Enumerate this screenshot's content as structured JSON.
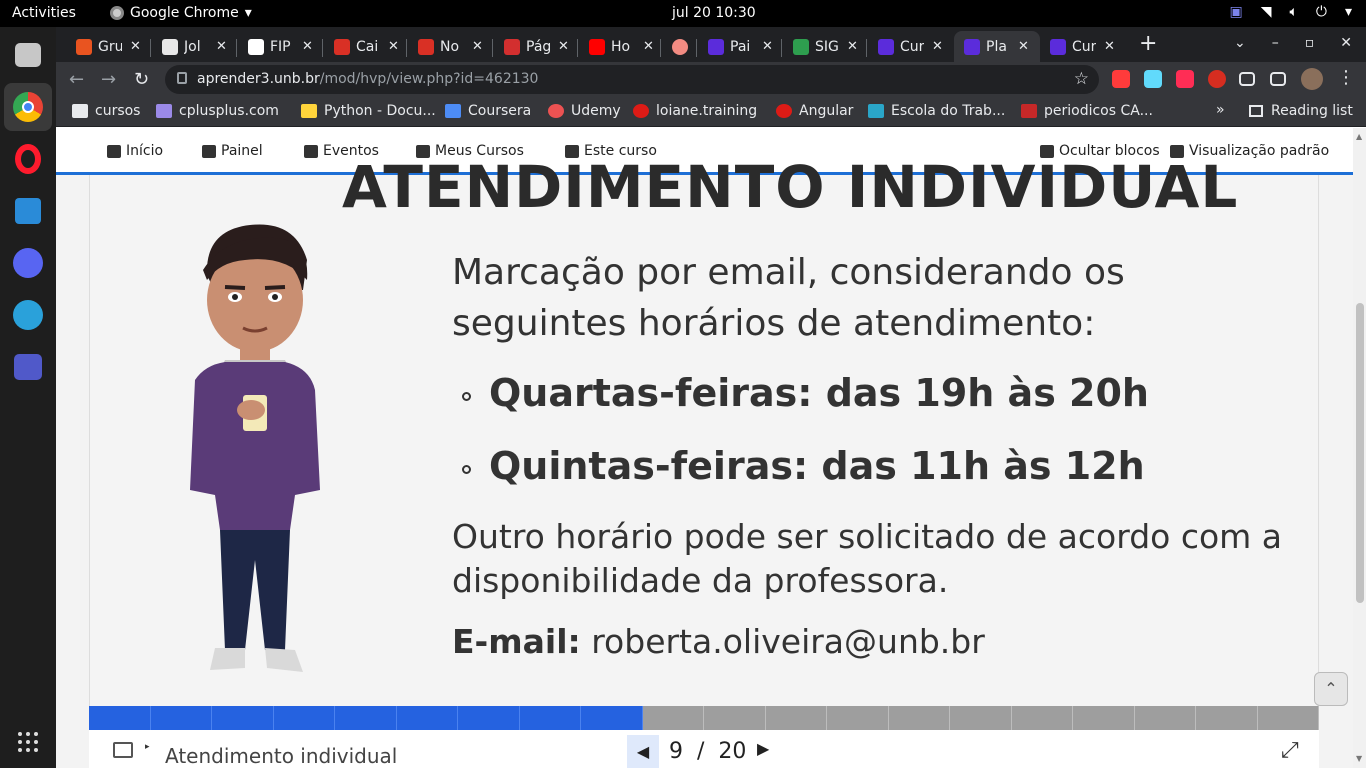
{
  "system_bar": {
    "activities": "Activities",
    "app_name": "Google Chrome",
    "app_menu_icon": "caret-down-icon",
    "clock": "jul 20  10:30",
    "tray_icons": [
      "teams-tray-icon",
      "wifi-icon",
      "volume-icon",
      "power-icon",
      "caret-down-icon"
    ]
  },
  "dock": {
    "items": [
      "files",
      "chrome",
      "opera",
      "vscode",
      "discord",
      "telegram",
      "teams"
    ],
    "colors": {
      "files": "#c7c7c7",
      "chrome": "#f4b400",
      "opera": "#ff1b2d",
      "vscode": "#2a8bd8",
      "discord": "#5865f2",
      "telegram": "#2aa1da",
      "teams": "#5059c9"
    }
  },
  "tabs": [
    {
      "label": "Gru",
      "favicon_color": "#e95420"
    },
    {
      "label": "Jol",
      "favicon_color": "#e8e8e8"
    },
    {
      "label": "FIP",
      "favicon_color": "#ffffff"
    },
    {
      "label": "Cai",
      "favicon_color": "#d93025"
    },
    {
      "label": "No",
      "favicon_color": "#d93025"
    },
    {
      "label": "Pág",
      "favicon_color": "#d32f2f"
    },
    {
      "label": "Ho",
      "favicon_color": "#ff0000"
    },
    {
      "label": "",
      "favicon_color": "#f28b82"
    },
    {
      "label": "Pai",
      "favicon_color": "#5b2cdb"
    },
    {
      "label": "SIG",
      "favicon_color": "#2e9e4f"
    },
    {
      "label": "Cur",
      "favicon_color": "#5b2cdb"
    },
    {
      "label": "Pla",
      "favicon_color": "#5b2cdb"
    },
    {
      "label": "Cur",
      "favicon_color": "#5b2cdb"
    }
  ],
  "active_tab_index": 11,
  "tab_close": "✕",
  "new_tab": "+",
  "window_controls": {
    "minimize": "–",
    "maximize": "▫",
    "close": "✕"
  },
  "toolbar": {
    "back": "←",
    "forward": "→",
    "reload": "↻",
    "url_host": "aprender3.unb.br",
    "url_path": "/mod/hvp/view.php?id=462130",
    "bookmark_star": "☆",
    "extensions": [
      "#ff3b3b",
      "#61dafb",
      "#ff2d55",
      "#d62d20",
      "#e8eaed",
      "#e8eaed"
    ],
    "menu": "⋮"
  },
  "bookmarks": {
    "items": [
      {
        "label": "cursos",
        "icon": "folder-icon",
        "color": "#e8eaed"
      },
      {
        "label": "cplusplus.com",
        "icon": "cplusplus-icon",
        "color": "#9b8ae8"
      },
      {
        "label": "Python - Docu...",
        "icon": "python-icon",
        "color": "#ffd43b"
      },
      {
        "label": "Coursera",
        "icon": "coursera-icon",
        "color": "#4d8cf5"
      },
      {
        "label": "Udemy",
        "icon": "udemy-icon",
        "color": "#ec5252"
      },
      {
        "label": "loiane.training",
        "icon": "angular-icon",
        "color": "#dd1b16"
      },
      {
        "label": "Angular",
        "icon": "angular-icon",
        "color": "#dd1b16"
      },
      {
        "label": "Escola do Trab...",
        "icon": "escola-icon",
        "color": "#2aa6c9"
      },
      {
        "label": "periodicos CA...",
        "icon": "periodicos-icon",
        "color": "#c62828"
      }
    ],
    "more": "»",
    "reading_list": "Reading list"
  },
  "moodle_nav": {
    "items": [
      {
        "label": "Início",
        "icon": "home-icon"
      },
      {
        "label": "Painel",
        "icon": "dashboard-icon"
      },
      {
        "label": "Eventos",
        "icon": "calendar-icon"
      },
      {
        "label": "Meus Cursos",
        "icon": "briefcase-icon"
      },
      {
        "label": "Este curso",
        "icon": "sitemap-icon"
      }
    ],
    "right": [
      {
        "label": "Ocultar blocos",
        "icon": "hide-blocks-icon"
      },
      {
        "label": "Visualização padrão",
        "icon": "collapse-icon"
      }
    ]
  },
  "slide": {
    "heading": "ATENDIMENTO INDIVIDUAL",
    "intro": "Marcação por email, considerando os seguintes horários de atendimento:",
    "slots": [
      "Quartas-feiras: das 19h às 20h",
      "Quintas-feiras: das 11h às 12h"
    ],
    "note": "Outro horário pode ser solicitado de acordo com a disponibilidade da professora.",
    "email_label": "E-mail:",
    "email_value": " roberta.oliveira@unb.br"
  },
  "progress": {
    "completed_segments": 9,
    "total_segments": 20
  },
  "footer": {
    "slide_title": "Atendimento individual",
    "current": "9",
    "separator": "/",
    "total": "20",
    "prev": "◀",
    "next": "▶",
    "fullscreen": "⤢"
  },
  "back_to_top": "⌃"
}
